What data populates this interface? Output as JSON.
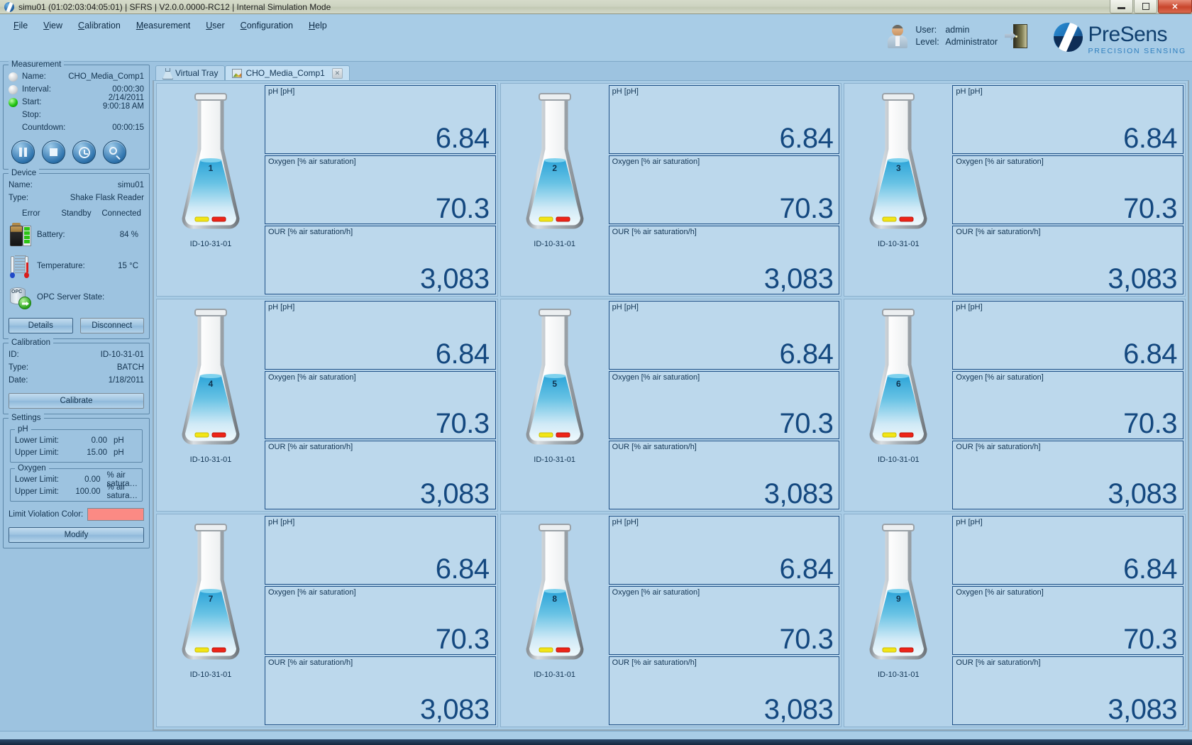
{
  "window": {
    "title": "simu01 (01:02:03:04:05:01) | SFRS | V2.0.0.0000-RC12 | Internal Simulation Mode",
    "app_icon": "presens-logo-icon",
    "minimize_label": "",
    "maximize_label": "",
    "close_label": "✕"
  },
  "menu": [
    {
      "label": "File",
      "accel": "F"
    },
    {
      "label": "View",
      "accel": "V"
    },
    {
      "label": "Calibration",
      "accel": "C"
    },
    {
      "label": "Measurement",
      "accel": "M"
    },
    {
      "label": "User",
      "accel": "U"
    },
    {
      "label": "Configuration",
      "accel": "C"
    },
    {
      "label": "Help",
      "accel": "H"
    }
  ],
  "user": {
    "user_label": "User:",
    "user_value": "admin",
    "level_label": "Level:",
    "level_value": "Administrator",
    "logout_icon": "logout-door-icon",
    "avatar_icon": "user-avatar-icon"
  },
  "brand": {
    "name": "PreSens",
    "tagline": "PRECISION SENSING",
    "mark": "presens-circle-logo"
  },
  "measurement": {
    "caption": "Measurement",
    "rows": [
      {
        "led": "grey",
        "key": "Name:",
        "value": "CHO_Media_Comp1"
      },
      {
        "led": "grey",
        "key": "Interval:",
        "value": "00:00:30"
      },
      {
        "led": "green",
        "key": "Start:",
        "value": "2/14/2011 9:00:18 AM"
      },
      {
        "led": "none",
        "key": "Stop:",
        "value": ""
      },
      {
        "led": "none",
        "key": "Countdown:",
        "value": "00:00:15"
      }
    ],
    "buttons": [
      {
        "name": "pause-button",
        "icon": "pause-icon"
      },
      {
        "name": "stop-button",
        "icon": "stop-icon"
      },
      {
        "name": "timer-button",
        "icon": "clock-icon"
      },
      {
        "name": "inspect-button",
        "icon": "magnifier-icon"
      }
    ]
  },
  "device": {
    "caption": "Device",
    "name_label": "Name:",
    "name_value": "simu01",
    "type_label": "Type:",
    "type_value": "Shake Flask Reader",
    "states": [
      {
        "label": "Error",
        "led": "grey"
      },
      {
        "label": "Standby",
        "led": "yellow"
      },
      {
        "label": "Connected",
        "led": "grey"
      }
    ],
    "metrics": [
      {
        "icon": "battery-icon",
        "label": "Battery:",
        "value": "84 %",
        "led": "green"
      },
      {
        "icon": "thermometer-icon",
        "label": "Temperature:",
        "value": "15 °C",
        "led": "green"
      },
      {
        "icon": "opc-server-icon",
        "label": "OPC Server State:",
        "value": "",
        "led": "red"
      }
    ],
    "details_button": "Details",
    "disconnect_button": "Disconnect"
  },
  "calibration": {
    "caption": "Calibration",
    "rows": [
      {
        "key": "ID:",
        "value": "ID-10-31-01"
      },
      {
        "key": "Type:",
        "value": "BATCH"
      },
      {
        "key": "Date:",
        "value": "1/18/2011"
      }
    ],
    "calibrate_button": "Calibrate"
  },
  "settings": {
    "caption": "Settings",
    "ph": {
      "caption": "pH",
      "lower_label": "Lower Limit:",
      "lower_value": "0.00",
      "lower_unit": "pH",
      "upper_label": "Upper Limit:",
      "upper_value": "15.00",
      "upper_unit": "pH"
    },
    "oxygen": {
      "caption": "Oxygen",
      "lower_label": "Lower Limit:",
      "lower_value": "0.00",
      "lower_unit": "% air satura…",
      "upper_label": "Upper Limit:",
      "upper_value": "100.00",
      "upper_unit": "% air satura…"
    },
    "violation_label": "Limit Violation Color:",
    "violation_color": "#fb8a84",
    "modify_button": "Modify"
  },
  "tabs": [
    {
      "label": "Virtual Tray",
      "icon": "flask-icon",
      "active": false,
      "closable": false
    },
    {
      "label": "CHO_Media_Comp1",
      "icon": "chart-icon",
      "active": true,
      "closable": true,
      "close_glyph": "✕"
    }
  ],
  "tray": {
    "metrics": [
      {
        "key": "ph",
        "label": "pH [pH]"
      },
      {
        "key": "oxygen",
        "label": "Oxygen [% air saturation]"
      },
      {
        "key": "our",
        "label": "OUR [% air saturation/h]"
      }
    ],
    "flasks": [
      {
        "number": "1",
        "id": "ID-10-31-01",
        "ph": "6.84",
        "oxygen": "70.3",
        "our": "3,083"
      },
      {
        "number": "2",
        "id": "ID-10-31-01",
        "ph": "6.84",
        "oxygen": "70.3",
        "our": "3,083"
      },
      {
        "number": "3",
        "id": "ID-10-31-01",
        "ph": "6.84",
        "oxygen": "70.3",
        "our": "3,083"
      },
      {
        "number": "4",
        "id": "ID-10-31-01",
        "ph": "6.84",
        "oxygen": "70.3",
        "our": "3,083"
      },
      {
        "number": "5",
        "id": "ID-10-31-01",
        "ph": "6.84",
        "oxygen": "70.3",
        "our": "3,083"
      },
      {
        "number": "6",
        "id": "ID-10-31-01",
        "ph": "6.84",
        "oxygen": "70.3",
        "our": "3,083"
      },
      {
        "number": "7",
        "id": "ID-10-31-01",
        "ph": "6.84",
        "oxygen": "70.3",
        "our": "3,083"
      },
      {
        "number": "8",
        "id": "ID-10-31-01",
        "ph": "6.84",
        "oxygen": "70.3",
        "our": "3,083"
      },
      {
        "number": "9",
        "id": "ID-10-31-01",
        "ph": "6.84",
        "oxygen": "70.3",
        "our": "3,083"
      }
    ]
  },
  "colors": {
    "accent": "#14487f",
    "panel": "#9dc3e0",
    "cell": "#b4d3ea",
    "led_green": "#21c411",
    "led_red": "#e81f10",
    "led_yellow": "#f5c211"
  }
}
